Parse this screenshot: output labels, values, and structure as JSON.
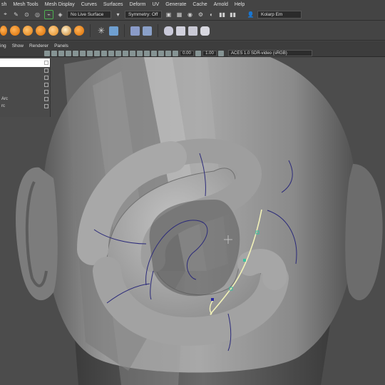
{
  "menubar": {
    "items": [
      "sh",
      "Mesh Tools",
      "Mesh Display",
      "Curves",
      "Surfaces",
      "Deform",
      "UV",
      "Generate",
      "Cache",
      "Arnold",
      "Help"
    ]
  },
  "status": {
    "live_surface": "No Live Surface",
    "symmetry": "Symmetry: Off",
    "user": "Kolarp Em"
  },
  "panel": {
    "menus": [
      "ing",
      "Show",
      "Renderer",
      "Panels"
    ],
    "exposure": "0.00",
    "gamma": "1.00",
    "colorspace": "ACES 1.0 SDR-video (sRGB)"
  },
  "outliner": {
    "rows": [
      "",
      "",
      "",
      "",
      "",
      "Arc",
      "rc",
      ""
    ]
  },
  "colors": {
    "ui_bg": "#444444",
    "viewport_bg": "#4c4c4c",
    "head": "#8e8e8e",
    "tube": "#a9a9a9",
    "isoparm": "#2b2a7a",
    "curve": "#f2f2b8",
    "cv_point": "#38c0a0"
  }
}
